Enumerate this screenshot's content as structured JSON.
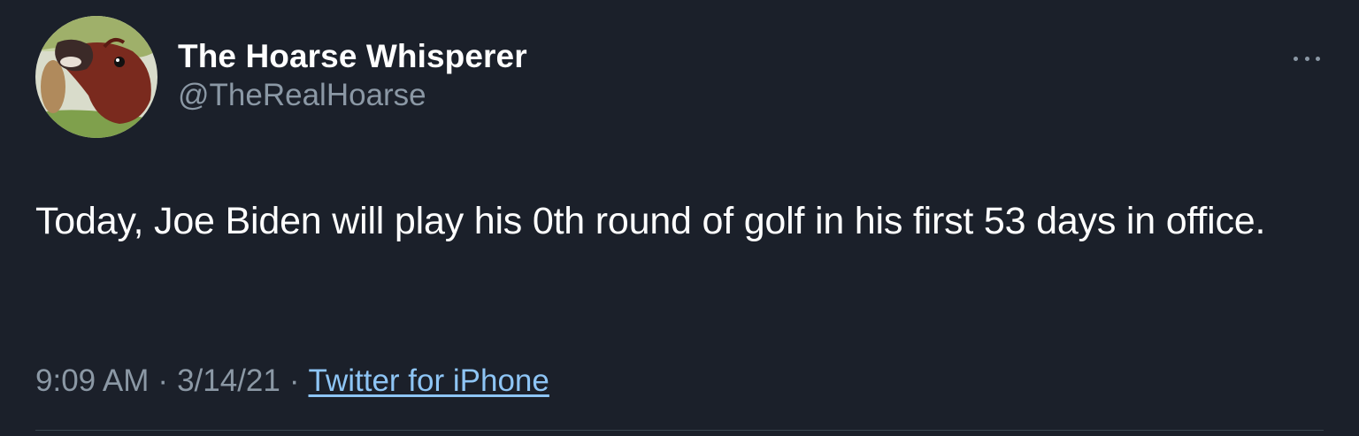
{
  "author": {
    "display_name": "The Hoarse Whisperer",
    "handle": "@TheRealHoarse"
  },
  "tweet": {
    "text": "Today, Joe Biden will play his 0th round of golf in his first 53 days in office.",
    "time": "9:09 AM",
    "date": "3/14/21",
    "separator": "·",
    "source": "Twitter for iPhone"
  },
  "icons": {
    "more": "more-horizontal-icon"
  },
  "colors": {
    "background": "#1b202a",
    "primary_text": "#ffffff",
    "secondary_text": "#8b98a5",
    "link": "#8ec5f5"
  }
}
